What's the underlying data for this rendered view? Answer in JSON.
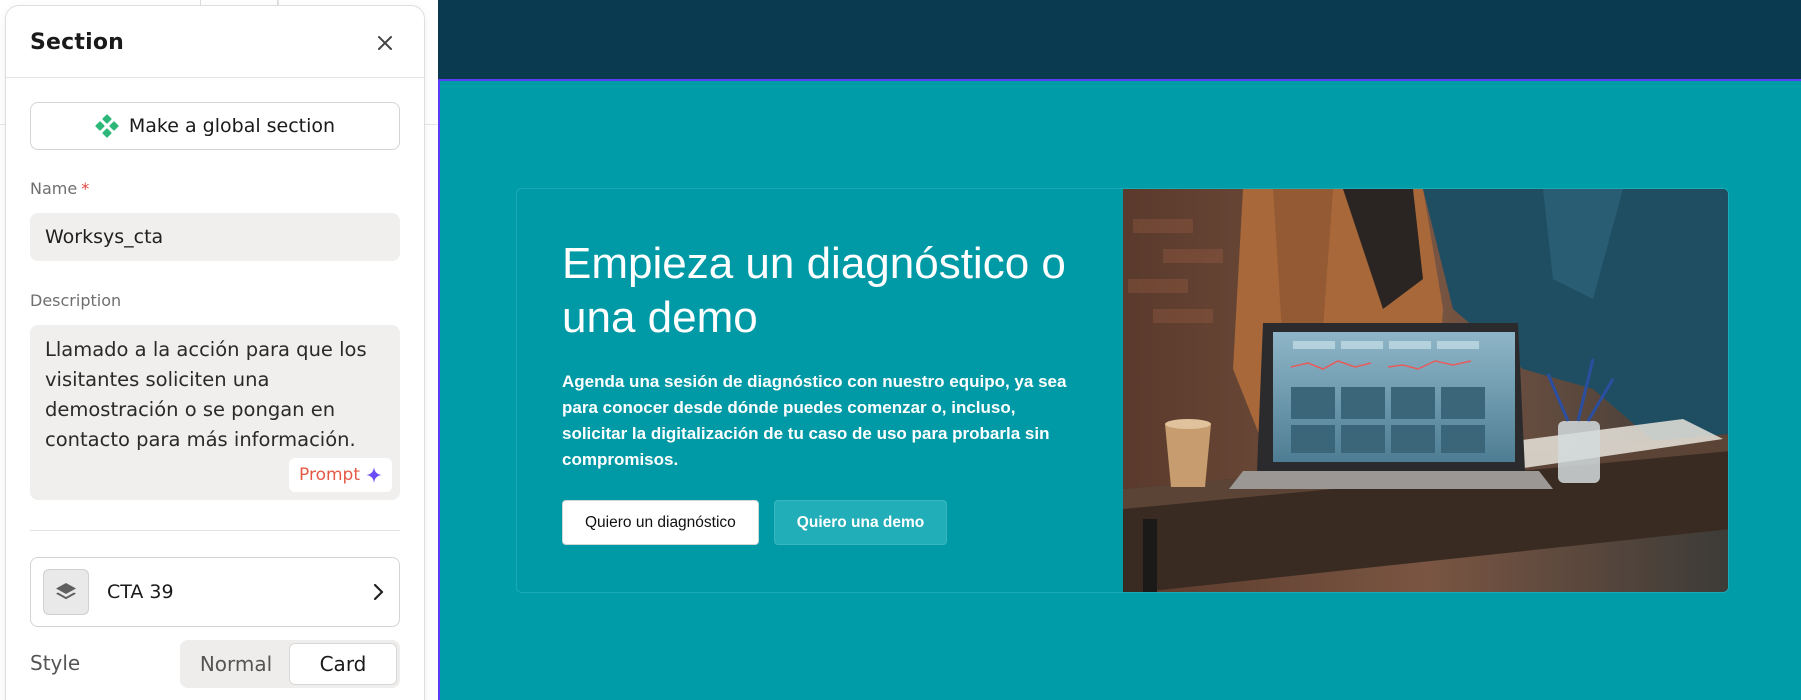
{
  "panel": {
    "title": "Section",
    "global_button_label": "Make a global section",
    "name_label": "Name",
    "name_required": "*",
    "name_value": "Worksys_cta",
    "description_label": "Description",
    "description_value": "Llamado a la acción para que los visitantes soliciten una demostración o se pongan en contacto para más información.",
    "prompt_label": "Prompt",
    "template_label": "CTA 39",
    "style_label": "Style",
    "style_options": [
      "Normal",
      "Card"
    ],
    "style_selected": "Card"
  },
  "preview": {
    "title": "Empieza un diagnóstico o una demo",
    "subtitle": "Agenda una sesión de diagnóstico con nuestro equipo, ya sea para conocer desde dónde puedes comenzar o, incluso, solicitar la digitalización de tu caso de uso para probarla sin compromisos.",
    "primary_button": "Quiero un diagnóstico",
    "secondary_button": "Quiero una demo"
  },
  "colors": {
    "header_bg": "#093a4f",
    "section_bg": "#009ca8",
    "selection_outline": "#5a3df5",
    "global_icon": "#2db87a",
    "prompt_text": "#e65a44",
    "prompt_sparkle": "#6b4ef5"
  },
  "icons": {
    "close": "close-icon",
    "global": "global-section-icon",
    "sparkle": "sparkle-icon",
    "layers": "layers-icon",
    "chevron": "chevron-right-icon"
  }
}
